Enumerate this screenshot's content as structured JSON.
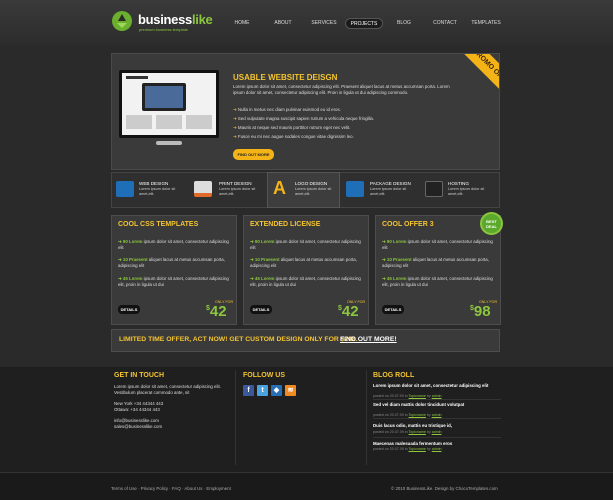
{
  "brand": {
    "name_a": "business",
    "name_b": "like",
    "tagline": "premium business template"
  },
  "nav": [
    "HOME",
    "ABOUT",
    "SERVICES",
    "PROJECTS",
    "BLOG",
    "CONTACT",
    "TEMPLATES"
  ],
  "promo": {
    "ribbon": "PROMO OFFER",
    "title": "USABLE WEBSITE DEISGN",
    "text": "Lorem ipsum dolor sit amet, consectetur adipiscing elit. Praesent aliquet lacus at metus accumsan porta. Lorem ipsum dolor sit amet, consectetur adipiscing elit. Proin in ligula ut dui adipiscing commodo.",
    "bullets": [
      "Nulla in metus nec diam pulvinar euismod eu id eros.",
      "Sed vulputate magna suscipit sapien rutrum a vehicula neque fringilla.",
      "Mauris at neque sed mauris porttitor rutrum eget nec velit.",
      "Fusce eu mi nec augue sodales congue vitae dignissim leo."
    ],
    "button": "FIND OUT MORE"
  },
  "services": [
    {
      "title": "WEB DESIGN",
      "text": "Lorem ipsum dolor sit amet,elit."
    },
    {
      "title": "PRINT DESIGN",
      "text": "Lorem ipsum dolor sit amet,elit."
    },
    {
      "title": "LOGO DESIGN",
      "text": "Lorem ipsum dolor sit amet,elit."
    },
    {
      "title": "PACKAGE DESIGN",
      "text": "Lorem ipsum dolor sit amet,elit."
    },
    {
      "title": "HOSTING",
      "text": "Lorem ipsum dolor sit amet,elit."
    }
  ],
  "cards": [
    {
      "title": "COOL CSS TEMPLATES",
      "lines": [
        {
          "n": "90 Lorem",
          "t": " ipsum dolor sit amet, consectetur adipiscing elit"
        },
        {
          "n": "10 Praesent",
          "t": " aliquet lacus at metus accumsan porta, adipiscing elit"
        },
        {
          "n": "45 Lorem",
          "t": " ipsum dolor sit amet, consectetur adipiscing elit, proin in ligula ut dui"
        }
      ],
      "button": "DETAILS",
      "only_for": "ONLY FOR",
      "price": "42"
    },
    {
      "title": "EXTENDED LICENSE",
      "lines": [
        {
          "n": "90 Lorem",
          "t": " ipsum dolor sit amet, consectetur adipiscing elit"
        },
        {
          "n": "10 Praesent",
          "t": " aliquet lacus at metus accumsan porta, adipiscing elit"
        },
        {
          "n": "45 Lorem",
          "t": " ipsum dolor sit amet, consectetur adipiscing elit, proin in ligula ut dui"
        }
      ],
      "button": "DETAILS",
      "only_for": "ONLY FOR",
      "price": "42"
    },
    {
      "title": "COOL OFFER 3",
      "lines": [
        {
          "n": "90 Lorem",
          "t": " ipsum dolor sit amet, consectetur adipiscing elit"
        },
        {
          "n": "10 Praesent",
          "t": " aliquet lacus at metus accumsan porta, adipiscing elit"
        },
        {
          "n": "45 Lorem",
          "t": " ipsum dolor sit amet, consectetur adipiscing elit, proin in ligula ut dui"
        }
      ],
      "button": "DETAILS",
      "only_for": "ONLY FOR",
      "price": "98"
    }
  ],
  "best_deal": {
    "line1": "BEST",
    "line2": "DEAL"
  },
  "currency": "$",
  "offer": {
    "text": "LIMITED TIME OFFER, ACT NOW! GET CUSTOM DESIGN ONLY FOR $298.",
    "link": "FIND OUT MORE!"
  },
  "footer": {
    "touch_title": "GET IN TOUCH",
    "touch_text": "Lorem ipsum dolor sit amet, consectetur adipiscing elit. Vestibulum placerat commodo ante, sit",
    "phone1": "New York +34 44344 443",
    "phone2": "Ottawa: +34 44344 443",
    "email1": "info@businesslike.com",
    "email2": "sales@businesslike.com",
    "follow_title": "FOLLOW US",
    "blog_title": "BLOG ROLL",
    "blog": [
      {
        "t": "Lorem ipsum dolor sit amet, consectetur adipiscing elit",
        "pre": "posted on 20.07.09 in ",
        "cat": "Topicname",
        "by": " by ",
        "author": "admin"
      },
      {
        "t": "Sed vel diam mattis dolor tincidunt volutpat",
        "pre": "posted on 20.07.09 in ",
        "cat": "Topicname",
        "by": " by ",
        "author": "admin"
      },
      {
        "t": "Duis lacus odio, mattis eu tristique id,",
        "pre": "posted on 20.07.09 in ",
        "cat": "Topicname",
        "by": " by ",
        "author": "admin"
      },
      {
        "t": "Maecenas malesuada fermentum eros",
        "pre": "posted on 20.07.09 in ",
        "cat": "Topicname",
        "by": " by ",
        "author": "admin"
      }
    ]
  },
  "bottom": {
    "links": "Terms of Use · Privacy Policy · FAQ · About Us · Employment",
    "copyright": "© 2010 BusinessLike. Design by ChocoTemplates.com"
  },
  "colors": {
    "accent": "#f4c430",
    "green": "#8cc63f",
    "bg": "#2a2a2a"
  }
}
